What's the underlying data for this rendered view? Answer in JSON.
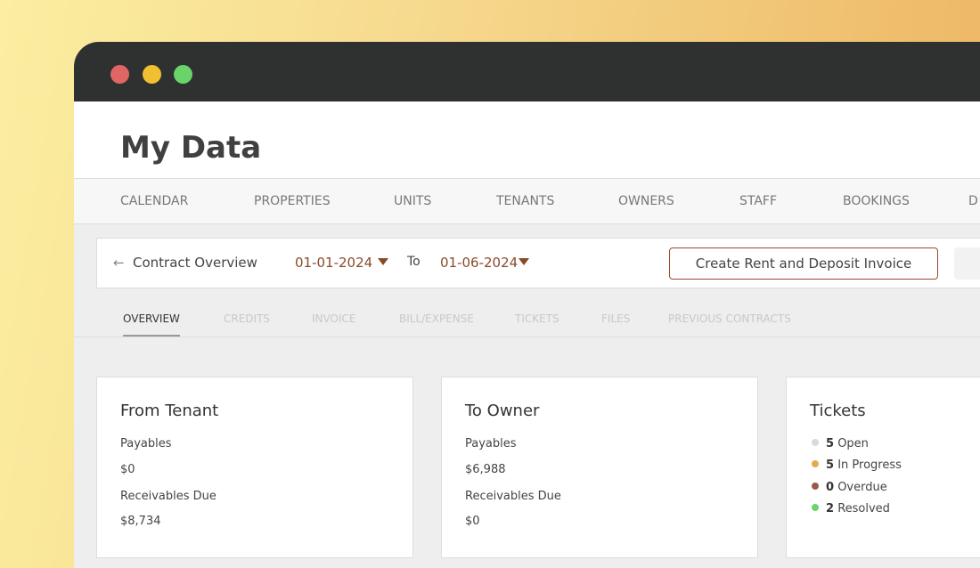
{
  "window": {
    "dot_colors": [
      "#e06666",
      "#f0c030",
      "#6ad46a"
    ]
  },
  "header": {
    "title": "My Data"
  },
  "nav": {
    "items": [
      "CALENDAR",
      "PROPERTIES",
      "UNITS",
      "TENANTS",
      "OWNERS",
      "STAFF",
      "BOOKINGS",
      "D"
    ]
  },
  "toolbar": {
    "back_icon": "arrow-left-icon",
    "title": "Contract Overview",
    "from_date": "01-01-2024",
    "to_label": "To",
    "to_date": "01-06-2024",
    "create_button": "Create Rent and Deposit Invoice"
  },
  "tabs": [
    "OVERVIEW",
    "CREDITS",
    "INVOICE",
    "BILL/EXPENSE",
    "TICKETS",
    "FILES",
    "PREVIOUS CONTRACTS"
  ],
  "cards": {
    "from_tenant": {
      "title": "From Tenant",
      "payables_label": "Payables",
      "payables": "$0",
      "receivables_label": "Receivables Due",
      "receivables": "$8,734"
    },
    "to_owner": {
      "title": "To Owner",
      "payables_label": "Payables",
      "payables": "$6,988",
      "receivables_label": "Receivables Due",
      "receivables": "$0"
    },
    "tickets": {
      "title": "Tickets",
      "items": [
        {
          "count": "5",
          "label": "Open",
          "color": "#d9d9d9"
        },
        {
          "count": "5",
          "label": "In Progress",
          "color": "#e8a94e"
        },
        {
          "count": "0",
          "label": "Overdue",
          "color": "#9a5a48"
        },
        {
          "count": "2",
          "label": "Resolved",
          "color": "#6cd46c"
        }
      ]
    }
  }
}
